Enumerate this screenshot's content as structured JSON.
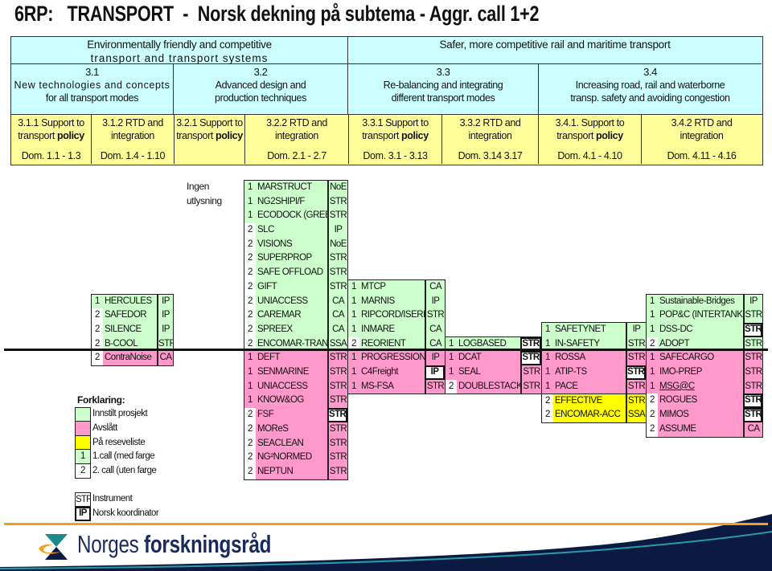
{
  "title": "6RP:   TRANSPORT  -  Norsk dekning på subtema - Aggr. call 1+2",
  "header": {
    "themes": [
      {
        "line1": "Environmentally friendly and competitive",
        "line2": "transport and transport systems"
      },
      {
        "line1": "Safer, more competitive rail and maritime transport",
        "line2": ""
      }
    ],
    "subthemes": [
      {
        "number": "3.1",
        "line1": "New technologies and concepts",
        "line2": "for all transport modes"
      },
      {
        "number": "3.2",
        "line1": "Advanced design and",
        "line2": "production techniques"
      },
      {
        "number": "3.3",
        "line1": "Re-balancing and integrating",
        "line2": "different transport modes"
      },
      {
        "number": "3.4",
        "line1": "Increasing road, rail and  waterborne",
        "line2": "transp. safety and avoiding congestion"
      }
    ],
    "areas": [
      {
        "line1": "3.1.1  Support to",
        "line2": "transport ",
        "bold": "policy",
        "dom": "Dom. 1.1 - 1.3"
      },
      {
        "line1": "3.1.2  RTD and",
        "line2": "integration",
        "bold": "",
        "dom": "Dom. 1.4 - 1.10"
      },
      {
        "line1": "3.2.1  Support to",
        "line2": "transport ",
        "bold": "policy",
        "dom": ""
      },
      {
        "line1": "3.2.2  RTD and",
        "line2": "integration",
        "bold": "",
        "dom": "Dom. 2.1  - 2.7"
      },
      {
        "line1": "3.3.1  Support to",
        "line2": "transport ",
        "bold": "policy",
        "dom": "Dom. 3.1 - 3.13"
      },
      {
        "line1": "3.3.2  RTD and",
        "line2": "integration",
        "bold": "",
        "dom": "Dom. 3.14  3.17"
      },
      {
        "line1": "3.4.1.  Support to",
        "line2": "transport ",
        "bold": "policy",
        "dom": "Dom.  4.1  - 4.10"
      },
      {
        "line1": "3.4.2  RTD and",
        "line2": "integration",
        "bold": "",
        "dom": "Dom.  4.11  - 4.16"
      }
    ]
  },
  "note": {
    "line1": "Ingen",
    "line2": "utlysning"
  },
  "columns": {
    "c31": {
      "area": "3.1.2",
      "blocks": [
        {
          "status": "innstilt",
          "items": [
            {
              "call": "1",
              "name": "HERCULES",
              "instrument": "IP",
              "coordinator": false
            },
            {
              "call": "2",
              "name": "SAFEDOR",
              "instrument": "IP",
              "coordinator": false
            },
            {
              "call": "2",
              "name": "SILENCE",
              "instrument": "IP",
              "coordinator": false
            },
            {
              "call": "2",
              "name": "B-COOL",
              "instrument": "STR",
              "coordinator": false
            }
          ]
        },
        {
          "status": "avslatt",
          "items": [
            {
              "call": "2",
              "name": "ContraNoise",
              "instrument": "CA",
              "coordinator": false
            }
          ]
        }
      ]
    },
    "c322": {
      "area": "3.2.2",
      "blocks": [
        {
          "status": "innstilt",
          "items": [
            {
              "call": "1",
              "name": "MARSTRUCT",
              "instrument": "NoE",
              "coordinator": false
            },
            {
              "call": "1",
              "name": "NG2SHIPI/F",
              "instrument": "STR",
              "coordinator": false
            },
            {
              "call": "1",
              "name": "ECODOCK (GREE",
              "instrument": "STR",
              "coordinator": false
            },
            {
              "call": "2",
              "name": "SLC",
              "instrument": "IP",
              "coordinator": false
            },
            {
              "call": "2",
              "name": "VISIONS",
              "instrument": "NoE",
              "coordinator": false
            },
            {
              "call": "2",
              "name": "SUPERPROP",
              "instrument": "STR",
              "coordinator": false
            },
            {
              "call": "2",
              "name": "SAFE OFFLOAD",
              "instrument": "STR",
              "coordinator": false
            },
            {
              "call": "2",
              "name": "GIFT",
              "instrument": "STR",
              "coordinator": false
            },
            {
              "call": "2",
              "name": "UNIACCESS",
              "instrument": "CA",
              "coordinator": false
            },
            {
              "call": "2",
              "name": "CAREMAR",
              "instrument": "CA",
              "coordinator": false
            },
            {
              "call": "2",
              "name": "SPREEX",
              "instrument": "CA",
              "coordinator": false
            },
            {
              "call": "2",
              "name": "ENCOMAR-TRANS",
              "instrument": "SSA",
              "coordinator": false
            }
          ]
        },
        {
          "status": "avslatt",
          "items": [
            {
              "call": "1",
              "name": "DEFT",
              "instrument": "STR",
              "coordinator": false
            },
            {
              "call": "1",
              "name": "SENMARINE",
              "instrument": "STR",
              "coordinator": false
            },
            {
              "call": "1",
              "name": "UNIACCESS",
              "instrument": "STR",
              "coordinator": false
            },
            {
              "call": "1",
              "name": "KNOW&OG",
              "instrument": "STR",
              "coordinator": false
            },
            {
              "call": "2",
              "name": "FSF",
              "instrument": "STR",
              "coordinator": true
            },
            {
              "call": "2",
              "name": "MOReS",
              "instrument": "STR",
              "coordinator": false
            },
            {
              "call": "2",
              "name": "SEACLEAN",
              "instrument": "STR",
              "coordinator": false
            },
            {
              "call": "2",
              "name": "NG²NORMED",
              "instrument": "STR",
              "coordinator": false
            },
            {
              "call": "2",
              "name": "NEPTUN",
              "instrument": "STR",
              "coordinator": false
            }
          ]
        }
      ]
    },
    "c331": {
      "area": "3.3.1",
      "blocks": [
        {
          "status": "innstilt",
          "items": [
            {
              "call": "1",
              "name": "MTCP",
              "instrument": "CA",
              "coordinator": false
            },
            {
              "call": "1",
              "name": "MARNIS",
              "instrument": "IP",
              "coordinator": false
            },
            {
              "call": "1",
              "name": "RIPCORD/ISERE",
              "instrument": "STR",
              "coordinator": false
            },
            {
              "call": "1",
              "name": "INMARE",
              "instrument": "CA",
              "coordinator": false
            },
            {
              "call": "2",
              "name": "REORIENT",
              "instrument": "CA",
              "coordinator": false
            }
          ]
        },
        {
          "status": "avslatt",
          "items": [
            {
              "call": "1",
              "name": "PROGRESSION",
              "instrument": "IP",
              "coordinator": false
            },
            {
              "call": "1",
              "name": "C4Freight",
              "instrument": "IP",
              "coordinator": true
            },
            {
              "call": "1",
              "name": "MS-FSA",
              "instrument": "STR",
              "coordinator": false
            }
          ]
        }
      ]
    },
    "c332": {
      "area": "3.3.2",
      "blocks": [
        {
          "status": "innstilt",
          "items": [
            {
              "call": "1",
              "name": "LOGBASED",
              "instrument": "STR",
              "coordinator": true
            }
          ]
        },
        {
          "status": "avslatt",
          "items": [
            {
              "call": "1",
              "name": "DCAT",
              "instrument": "STR",
              "coordinator": true
            },
            {
              "call": "1",
              "name": "SEAL",
              "instrument": "STR",
              "coordinator": false
            },
            {
              "call": "2",
              "name": "DOUBLESTACK",
              "instrument": "STR",
              "coordinator": false
            }
          ]
        }
      ]
    },
    "c341": {
      "area": "3.4.1",
      "blocks": [
        {
          "status": "innstilt",
          "items": [
            {
              "call": "1",
              "name": "SAFETYNET",
              "instrument": "IP",
              "coordinator": false
            },
            {
              "call": "1",
              "name": "IN-SAFETY",
              "instrument": "STR",
              "coordinator": false
            }
          ]
        },
        {
          "status": "avslatt",
          "items": [
            {
              "call": "1",
              "name": "ROSSA",
              "instrument": "STR",
              "coordinator": false
            },
            {
              "call": "1",
              "name": "ATIP-TS",
              "instrument": "STR",
              "coordinator": true
            },
            {
              "call": "1",
              "name": "PACE",
              "instrument": "STR",
              "coordinator": false
            }
          ]
        },
        {
          "status": "reserveliste",
          "items": [
            {
              "call": "2",
              "name": "EFFECTIVE",
              "instrument": "STR",
              "coordinator": false
            },
            {
              "call": "2",
              "name": "ENCOMAR-ACC",
              "instrument": "SSA",
              "coordinator": false
            }
          ]
        }
      ]
    },
    "c342": {
      "area": "3.4.2",
      "blocks": [
        {
          "status": "innstilt",
          "items": [
            {
              "call": "1",
              "name": "Sustainable-Bridges",
              "instrument": "IP",
              "coordinator": false
            },
            {
              "call": "1",
              "name": "POP&C (INTERTANKO",
              "instrument": "STR",
              "coordinator": false
            },
            {
              "call": "1",
              "name": "DSS-DC",
              "instrument": "STR",
              "coordinator": true
            },
            {
              "call": "2",
              "name": "ADOPT",
              "instrument": "STR",
              "coordinator": false
            }
          ]
        },
        {
          "status": "avslatt",
          "items": [
            {
              "call": "1",
              "name": "SAFECARGO",
              "instrument": "STR",
              "coordinator": false
            },
            {
              "call": "1",
              "name": "IMO-PREP",
              "instrument": "STR",
              "coordinator": false
            },
            {
              "call": "1",
              "name": "MSG@C",
              "instrument": "STR",
              "coordinator": false,
              "underlined": true
            },
            {
              "call": "2",
              "name": "ROGUES",
              "instrument": "STR",
              "coordinator": true
            },
            {
              "call": "2",
              "name": "MIMOS",
              "instrument": "STR",
              "coordinator": true
            },
            {
              "call": "2",
              "name": "ASSUME",
              "instrument": "CA",
              "coordinator": false
            }
          ]
        }
      ]
    }
  },
  "legend": {
    "title": "Forklaring:",
    "innstilt": "Innstilt prosjekt",
    "avslatt": "Avslått",
    "reserve": "På reseveliste",
    "call1_swatch": "1",
    "call1": "1.call (med farge",
    "call2_swatch": "2",
    "call2": "2. call (uten farge",
    "instrument_swatch": "STR",
    "instrument": "Instrument",
    "coordinator_swatch": "IP",
    "coordinator": "Norsk koordinator"
  },
  "footer": {
    "logo_regular": "Norges ",
    "logo_bold": "forskningsråd"
  },
  "colors": {
    "header_blue": "#ccffff",
    "header_yellow": "#ffff99",
    "innstilt": "#ccffcc",
    "avslatt": "#ff99cc",
    "reserveliste": "#ffff00",
    "brand_navy": "#1a2a5a",
    "brand_orange": "#f0a020",
    "brand_teal": "#1a8a8a"
  }
}
